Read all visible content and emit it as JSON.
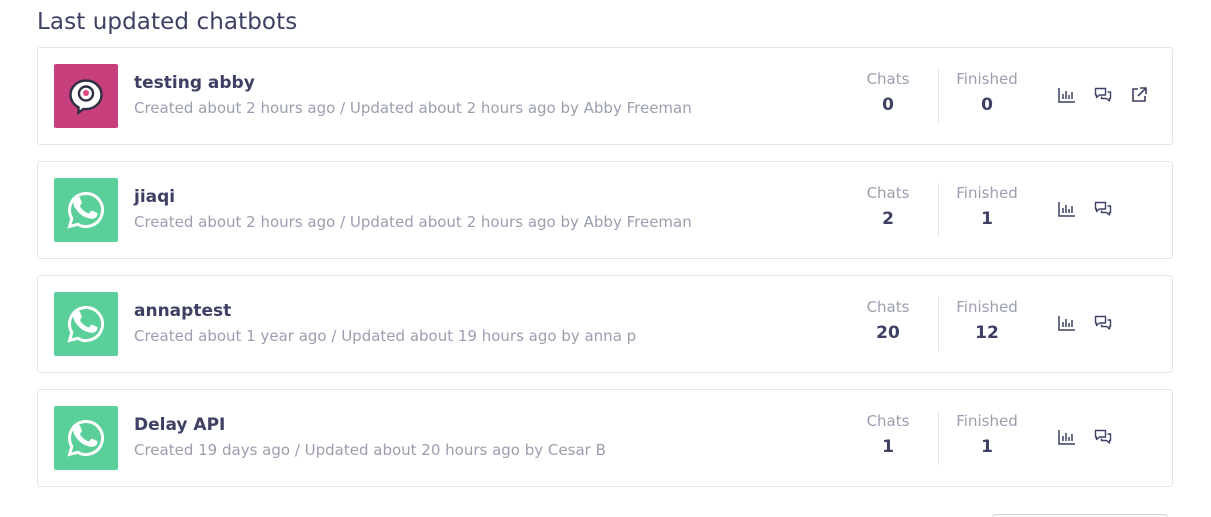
{
  "section_title": "Last updated chatbots",
  "labels": {
    "chats": "Chats",
    "finished": "Finished"
  },
  "chatbots": [
    {
      "name": "testing abby",
      "meta": "Created about 2 hours ago / Updated about 2 hours ago by Abby Freeman",
      "chats": "0",
      "finished": "0",
      "icon": "webchat-bubble-icon",
      "icon_bg": "#c83f7d",
      "actions": [
        "stats-icon",
        "conversations-icon",
        "external-link-icon"
      ]
    },
    {
      "name": "jiaqi",
      "meta": "Created about 2 hours ago / Updated about 2 hours ago by Abby Freeman",
      "chats": "2",
      "finished": "1",
      "icon": "whatsapp-icon",
      "icon_bg": "#5bcf9a",
      "actions": [
        "stats-icon",
        "conversations-icon"
      ]
    },
    {
      "name": "annaptest",
      "meta": "Created about 1 year ago / Updated about 19 hours ago by anna p",
      "chats": "20",
      "finished": "12",
      "icon": "whatsapp-icon",
      "icon_bg": "#5bcf9a",
      "actions": [
        "stats-icon",
        "conversations-icon"
      ]
    },
    {
      "name": "Delay API",
      "meta": "Created 19 days ago / Updated about 20 hours ago by Cesar B",
      "chats": "1",
      "finished": "1",
      "icon": "whatsapp-icon",
      "icon_bg": "#5bcf9a",
      "actions": [
        "stats-icon",
        "conversations-icon"
      ]
    }
  ],
  "colors": {
    "text_primary": "#3d4062",
    "text_muted": "#9b9eb0",
    "border": "#e4e5ea",
    "icon": "#3d4062"
  }
}
